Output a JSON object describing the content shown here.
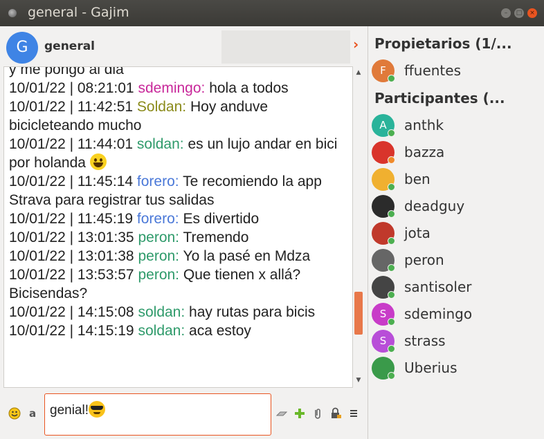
{
  "window": {
    "title": "general - Gajim"
  },
  "colors": {
    "accent": "#e95420",
    "online": "#4caf50"
  },
  "header": {
    "avatar_letter": "G",
    "room_name": "general",
    "chevron": "›"
  },
  "messages": [
    {
      "text": "y me pongo al dia"
    },
    {
      "ts": "10/01/22 | 08:21:01",
      "nick": "sdemingo:",
      "color": "#c8289a",
      "text": "hola a todos"
    },
    {
      "ts": "10/01/22 | 11:42:51",
      "nick": "Soldan:",
      "color": "#8a8a1a",
      "text": "Hoy anduve bicicleteando mucho"
    },
    {
      "ts": "10/01/22 | 11:44:01",
      "nick": "soldan:",
      "color": "#2e9a6a",
      "text": "es un lujo andar en bici por holanda",
      "emoji": true
    },
    {
      "ts": "10/01/22 | 11:45:14",
      "nick": "forero:",
      "color": "#4a78d8",
      "text": "Te recomiendo la app Strava para registrar tus salidas"
    },
    {
      "ts": "10/01/22 | 11:45:19",
      "nick": "forero:",
      "color": "#4a78d8",
      "text": "Es divertido"
    },
    {
      "ts": "10/01/22 | 13:01:35",
      "nick": "peron:",
      "color": "#2e9a6a",
      "text": "Tremendo"
    },
    {
      "ts": "10/01/22 | 13:01:38",
      "nick": "peron:",
      "color": "#2e9a6a",
      "text": "Yo la pasé en Mdza"
    },
    {
      "ts": "10/01/22 | 13:53:57",
      "nick": "peron:",
      "color": "#2e9a6a",
      "text": "Que tienen x allá? Bicisendas?"
    },
    {
      "ts": "10/01/22 | 14:15:08",
      "nick": "soldan:",
      "color": "#2e9a6a",
      "text": "hay rutas para bicis"
    },
    {
      "ts": "10/01/22 | 14:15:19",
      "nick": "soldan:",
      "color": "#2e9a6a",
      "text": "aca estoy"
    }
  ],
  "composer": {
    "text": "genial!"
  },
  "toolbar": {
    "emoji_icon": "emoji-smiley-icon",
    "format_icon": "format-text-icon",
    "send_file_icon": "send-file-icon",
    "add_icon": "plus-icon",
    "attach_icon": "paperclip-icon",
    "encryption_icon": "lock-icon",
    "menu_icon": "hamburger-menu-icon"
  },
  "roster": {
    "owners_label": "Propietarios (1/...",
    "participants_label": "Participantes (...",
    "owners": [
      {
        "name": "ffuentes",
        "letter": "F",
        "bg": "#e07a3a",
        "status": "#4caf50"
      }
    ],
    "participants": [
      {
        "name": "anthk",
        "letter": "A",
        "bg": "#2ab39a",
        "status": "#4caf50"
      },
      {
        "name": "bazza",
        "letter": "",
        "bg": "#d9342b",
        "status": "#f08a2a"
      },
      {
        "name": "ben",
        "letter": "",
        "bg": "#f0b030",
        "status": "#4caf50"
      },
      {
        "name": "deadguy",
        "letter": "",
        "bg": "#2b2b2b",
        "status": "#4caf50"
      },
      {
        "name": "jota",
        "letter": "",
        "bg": "#c0392b",
        "status": "#4caf50"
      },
      {
        "name": "peron",
        "letter": "",
        "bg": "#666666",
        "status": "#4caf50"
      },
      {
        "name": "santisoler",
        "letter": "",
        "bg": "#444444",
        "status": "#4caf50"
      },
      {
        "name": "sdemingo",
        "letter": "S",
        "bg": "#c83cc8",
        "status": "#4caf50"
      },
      {
        "name": "strass",
        "letter": "S",
        "bg": "#b84ed8",
        "status": "#4caf50"
      },
      {
        "name": "Uberius",
        "letter": "",
        "bg": "#3a9a4a",
        "status": "#4caf50"
      }
    ]
  }
}
